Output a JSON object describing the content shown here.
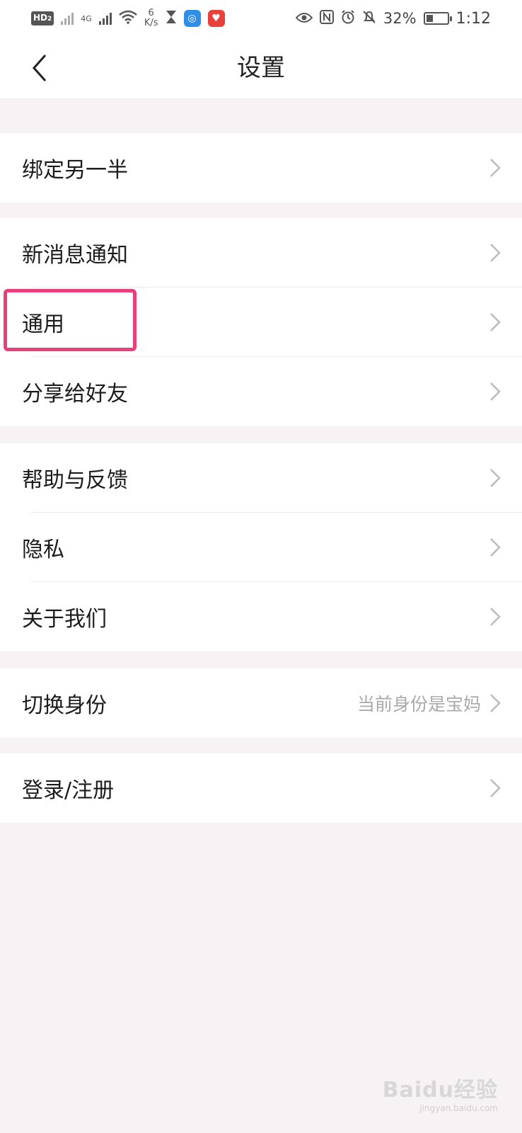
{
  "status_bar": {
    "hd_label": "HD",
    "hd_sub": "2",
    "net_label": "4G",
    "speed_value": "6",
    "speed_unit": "K/s",
    "battery_pct": "32%",
    "battery_level": 0.32,
    "time": "1:12"
  },
  "header": {
    "title": "设置"
  },
  "groups": [
    {
      "items": [
        {
          "label": "绑定另一半"
        }
      ]
    },
    {
      "items": [
        {
          "label": "新消息通知"
        },
        {
          "label": "通用"
        },
        {
          "label": "分享给好友"
        }
      ]
    },
    {
      "items": [
        {
          "label": "帮助与反馈"
        },
        {
          "label": "隐私"
        },
        {
          "label": "关于我们"
        }
      ]
    },
    {
      "items": [
        {
          "label": "切换身份",
          "value": "当前身份是宝妈"
        }
      ]
    },
    {
      "items": [
        {
          "label": "登录/注册"
        }
      ]
    }
  ],
  "watermark": {
    "main": "Baidu经验",
    "sub": "jingyan.baidu.com"
  },
  "colors": {
    "highlight": "#e8407a",
    "background": "#f7f2f3"
  }
}
